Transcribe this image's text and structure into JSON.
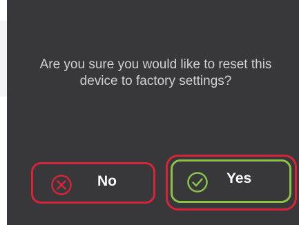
{
  "dialog": {
    "message": "Are you sure you would like to reset this device to factory settings?",
    "no_label": "No",
    "yes_label": "Yes",
    "no_icon": "close-circle-icon",
    "yes_icon": "check-circle-icon"
  },
  "colors": {
    "background": "#38383a",
    "message_text": "#d2d2d4",
    "highlight_red": "#d7243a",
    "confirm_green": "#8ac24a",
    "label_text": "#ffffff"
  }
}
